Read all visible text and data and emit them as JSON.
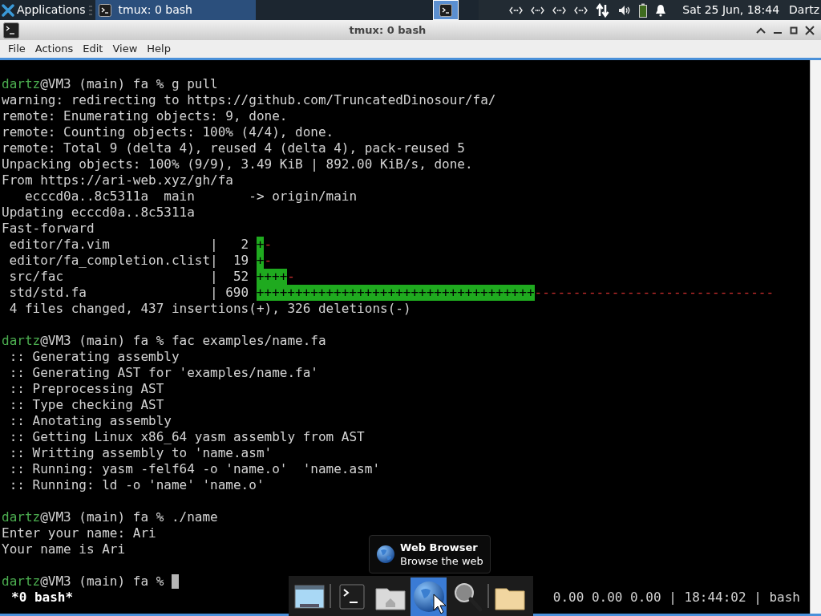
{
  "panel": {
    "app_menu": "Applications",
    "tasks": [
      {
        "label": "tmux: 0 bash",
        "selected": true
      }
    ],
    "workspaces": [
      {
        "selected": true
      }
    ],
    "clock": "Sat 25 Jun, 18:44",
    "user": "Dartz"
  },
  "window": {
    "title": "tmux: 0 bash"
  },
  "menu": [
    "File",
    "Actions",
    "Edit",
    "View",
    "Help"
  ],
  "terminal": {
    "lines": [
      {
        "kind": "blank"
      },
      {
        "kind": "prompt",
        "user": "dartz",
        "host": "@VM3 (main) fa % ",
        "command": "g pull",
        "cursor": false
      },
      {
        "kind": "output",
        "text": "warning: redirecting to https://github.com/TruncatedDinosour/fa/"
      },
      {
        "kind": "output",
        "text": "remote: Enumerating objects: 9, done."
      },
      {
        "kind": "output",
        "text": "remote: Counting objects: 100% (4/4), done."
      },
      {
        "kind": "output",
        "text": "remote: Total 9 (delta 4), reused 4 (delta 4), pack-reused 5"
      },
      {
        "kind": "output",
        "text": "Unpacking objects: 100% (9/9), 3.49 KiB | 892.00 KiB/s, done."
      },
      {
        "kind": "output",
        "text": "From https://ari-web.xyz/gh/fa"
      },
      {
        "kind": "output",
        "text": "   ecccd0a..8c5311a  main       -> origin/main"
      },
      {
        "kind": "output",
        "text": "Updating ecccd0a..8c5311a"
      },
      {
        "kind": "output",
        "text": "Fast-forward"
      },
      {
        "kind": "diffstat",
        "file": "editor/fa.vim",
        "separator": "|",
        "count": "2",
        "plus": "+",
        "minus": "-"
      },
      {
        "kind": "diffstat",
        "file": "editor/fa_completion.clist",
        "separator": "|",
        "count": "19",
        "plus": "+",
        "minus": "-"
      },
      {
        "kind": "diffstat",
        "file": "src/fac",
        "separator": "|",
        "count": "52",
        "plus": "++++",
        "minus": "-"
      },
      {
        "kind": "diffstat",
        "file": "std/std.fa",
        "separator": "|",
        "count": "690",
        "plus": "++++++++++++++++++++++++++++++++++++",
        "minus": "-------------------------------"
      },
      {
        "kind": "output",
        "text": " 4 files changed, 437 insertions(+), 326 deletions(-)"
      },
      {
        "kind": "blank"
      },
      {
        "kind": "prompt",
        "user": "dartz",
        "host": "@VM3 (main) fa % ",
        "command": "fac examples/name.fa",
        "cursor": false
      },
      {
        "kind": "output",
        "text": " :: Generating assembly"
      },
      {
        "kind": "output",
        "text": " :: Generating AST for 'examples/name.fa'"
      },
      {
        "kind": "output",
        "text": " :: Preprocessing AST"
      },
      {
        "kind": "output",
        "text": " :: Type checking AST"
      },
      {
        "kind": "output",
        "text": " :: Anotating assembly"
      },
      {
        "kind": "output",
        "text": " :: Getting Linux x86_64 yasm assembly from AST"
      },
      {
        "kind": "output",
        "text": " :: Writting assembly to 'name.asm'"
      },
      {
        "kind": "output",
        "text": " :: Running: yasm -felf64 -o 'name.o'  'name.asm'"
      },
      {
        "kind": "output",
        "text": " :: Running: ld -o 'name' 'name.o'"
      },
      {
        "kind": "blank"
      },
      {
        "kind": "prompt",
        "user": "dartz",
        "host": "@VM3 (main) fa % ",
        "command": "./name",
        "cursor": false
      },
      {
        "kind": "output",
        "text": "Enter your name: Ari"
      },
      {
        "kind": "output",
        "text": "Your name is Ari"
      },
      {
        "kind": "blank"
      },
      {
        "kind": "prompt",
        "user": "dartz",
        "host": "@VM3 (main) fa % ",
        "cursor": true
      }
    ]
  },
  "status": {
    "left": "*0 bash*",
    "right": "0.00 0.00 0.00 | 18:44:02 | bash"
  },
  "tooltip": {
    "title": "Web Browser",
    "subtitle": "Browse the web"
  },
  "dock": {
    "groups": [
      {
        "items": [
          {
            "kind": "desktop",
            "selected": false
          }
        ]
      },
      {
        "items": [
          {
            "kind": "terminal",
            "selected": false
          },
          {
            "kind": "home",
            "selected": false
          },
          {
            "kind": "browser",
            "selected": true
          },
          {
            "kind": "search",
            "selected": false
          }
        ]
      },
      {
        "items": [
          {
            "kind": "folder",
            "selected": false
          }
        ]
      }
    ]
  }
}
